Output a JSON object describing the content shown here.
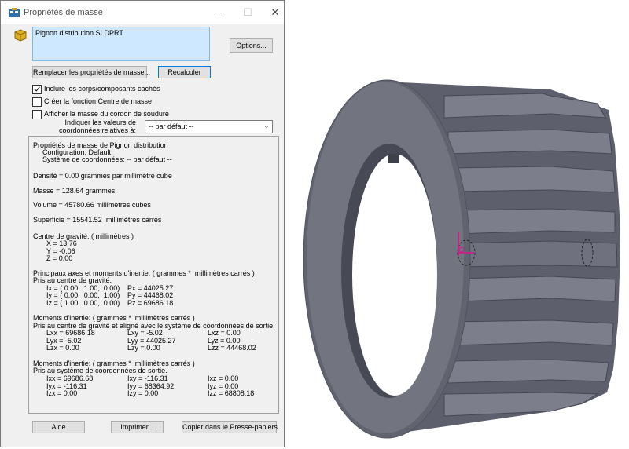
{
  "dialog": {
    "title": "Propriétés de masse",
    "selection": "Pignon distribution.SLDPRT",
    "options_button": "Options...",
    "override_button": "Remplacer les propriétés de masse...",
    "recalc_button": "Recalculer",
    "checkboxes": [
      {
        "label": "Inclure les corps/composants cachés",
        "checked": true
      },
      {
        "label": "Créer la fonction Centre de masse",
        "checked": false
      },
      {
        "label": "Afficher la masse du cordon de soudure",
        "checked": false
      }
    ],
    "coord_label_1": "Indiquer les valeurs de",
    "coord_label_2": "coordonnées relatives à:",
    "coord_value": "-- par défaut --",
    "help_button": "Aide",
    "print_button": "Imprimer...",
    "copy_button": "Copier dans le Presse-papiers"
  },
  "results": {
    "header": "Propriétés de masse de Pignon distribution",
    "config": "Configuration: Default",
    "coord_sys": "Système de coordonnées: -- par défaut --",
    "density": "Densité = 0.00 grammes par millimètre cube",
    "mass": "Masse = 128.64 grammes",
    "volume": "Volume = 45780.66 millimètres cubes",
    "surface": "Superficie = 15541.52  millimètres carrés",
    "cog_title": "Centre de gravité: ( millimètres )",
    "cog_x": "X = 13.76",
    "cog_y": "Y = -0.06",
    "cog_z": "Z = 0.00",
    "pa_title": "Principaux axes et moments d'inertie: ( grammes *  millimètres carrés )",
    "pa_sub": "Pris au centre de gravité.",
    "ix": "Ix = ( 0.00,  1.00,  0.00)",
    "iy": "Iy = ( 0.00,  0.00,  1.00)",
    "iz": "Iz = ( 1.00,  0.00,  0.00)",
    "px": "Px = 44025.27",
    "py": "Py = 44468.02",
    "pz": "Pz = 69686.18",
    "mi1_title": "Moments d'inertie: ( grammes *  millimètres carrés )",
    "mi1_sub": "Pris au centre de gravité et aligné avec le système de coordonnées de sortie.",
    "lxx": "Lxx = 69686.18",
    "lxy": "Lxy = -5.02",
    "lxz": "Lxz = 0.00",
    "lyx": "Lyx = -5.02",
    "lyy": "Lyy = 44025.27",
    "lyz": "Lyz = 0.00",
    "lzx": "Lzx = 0.00",
    "lzy": "Lzy = 0.00",
    "lzz": "Lzz = 44468.02",
    "mi2_title": "Moments d'inertie: ( grammes *  millimètres carrés )",
    "mi2_sub": "Pris au système de coordonnées de sortie.",
    "ixx": "Ixx = 69686.68",
    "ixy": "Ixy = -116.31",
    "ixz": "Ixz = 0.00",
    "iyx": "Iyx = -116.31",
    "iyy": "Iyy = 68364.92",
    "iyz": "Iyz = 0.00",
    "izx": "Izx = 0.00",
    "izy": "Izy = 0.00",
    "izz": "Izz = 68808.18"
  },
  "colors": {
    "selection_bg": "#cde8ff",
    "part_body": "#6b6e7a",
    "part_flange": "#5f626c"
  }
}
